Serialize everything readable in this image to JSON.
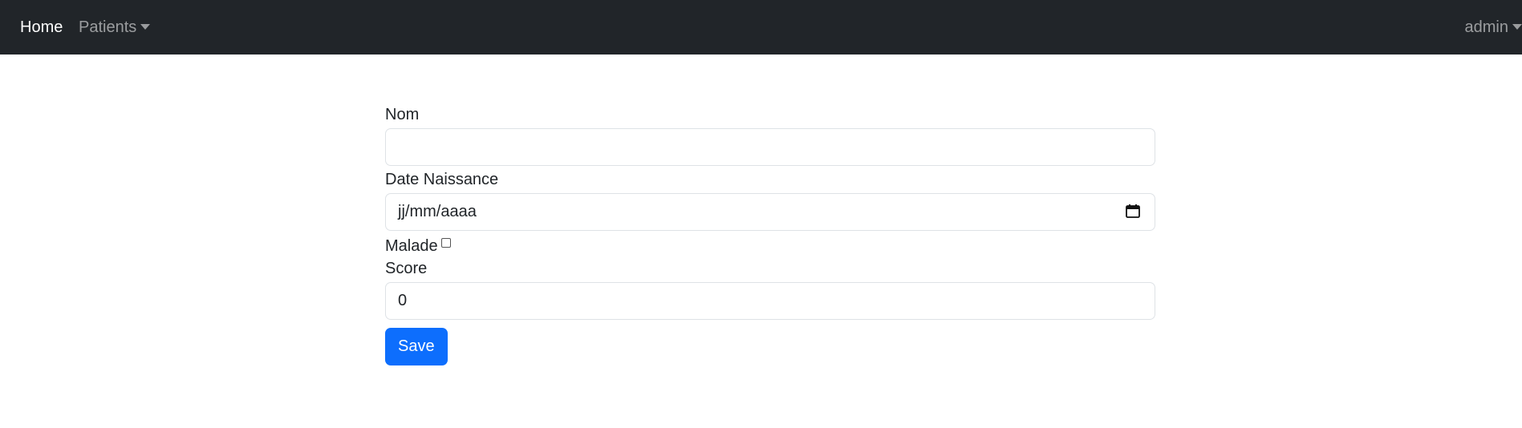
{
  "navbar": {
    "home_label": "Home",
    "patients_label": "Patients",
    "user_label": "admin"
  },
  "form": {
    "nom": {
      "label": "Nom",
      "value": ""
    },
    "date_naissance": {
      "label": "Date Naissance",
      "placeholder": "jj/mm/aaaa"
    },
    "malade": {
      "label": "Malade",
      "checked": false
    },
    "score": {
      "label": "Score",
      "value": "0"
    },
    "save_label": "Save"
  },
  "colors": {
    "navbar_bg": "#212529",
    "primary": "#0d6efd",
    "border": "#dee2e6"
  },
  "icons": {
    "dropdown": "chevron-down-icon",
    "calendar": "calendar-icon"
  }
}
